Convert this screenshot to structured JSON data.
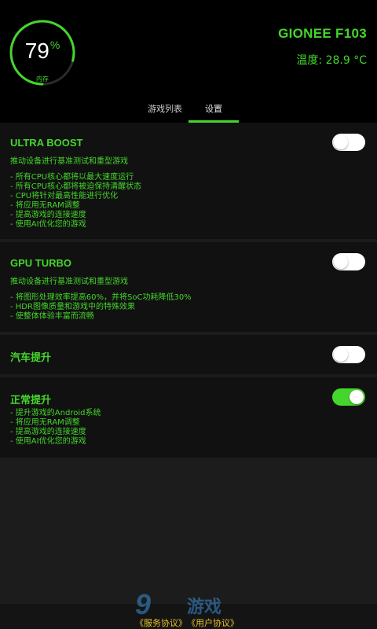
{
  "header": {
    "gauge": {
      "value": "79",
      "unit": "%",
      "label": "内存",
      "percent": 0.79
    },
    "device_name": "GIONEE F103",
    "temperature": "温度: 28.9 °C"
  },
  "tabs": [
    {
      "label": "游戏列表",
      "active": false
    },
    {
      "label": "设置",
      "active": true
    }
  ],
  "settings": [
    {
      "title": "ULTRA BOOST",
      "description": "推动设备进行基准测试和重型游戏",
      "bullets": [
        "- 所有CPU核心都将以最大速度运行",
        "- 所有CPU核心都将被迫保持清醒状态",
        "- CPU将针对最高性能进行优化",
        "- 将应用无RAM调整",
        "- 提高游戏的连接速度",
        "- 使用AI优化您的游戏"
      ],
      "enabled": false
    },
    {
      "title": "GPU TURBO",
      "description": "推动设备进行基准测试和重型游戏",
      "bullets": [
        "- 将图形处理效率提高60%，并将SoC功耗降低30%",
        "- HDR图像质量和游戏中的特殊效果",
        "- 使整体体验丰富而流畅"
      ],
      "enabled": false
    },
    {
      "title": "汽车提升",
      "description": "",
      "bullets": [],
      "enabled": false
    },
    {
      "title": "正常提升",
      "description": "",
      "bullets": [
        "- 提升游戏的Android系统",
        "- 将应用无RAM调整",
        "- 提高游戏的连接速度",
        "- 使用AI优化您的游戏"
      ],
      "enabled": true
    }
  ],
  "footer": {
    "links": [
      "《服务协议》",
      "《用户协议》"
    ],
    "watermark_number": "9",
    "watermark_text": "游戏"
  },
  "colors": {
    "accent": "#44d62c",
    "background": "#000000",
    "card": "#111111",
    "link": "#e8c02a"
  }
}
